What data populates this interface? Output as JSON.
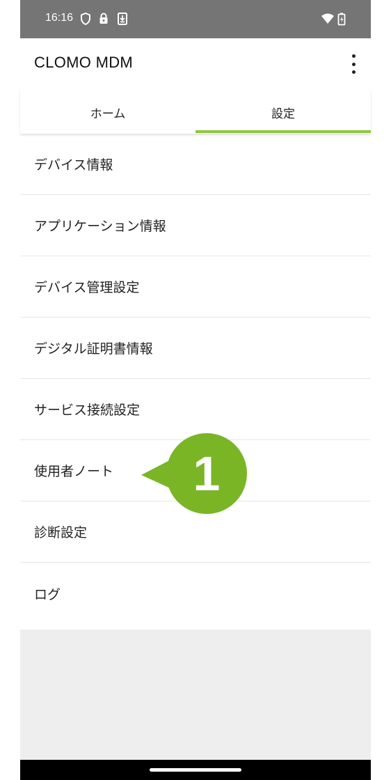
{
  "status_bar": {
    "time": "16:16",
    "icons": [
      "shield-icon",
      "lock-icon",
      "download-icon",
      "wifi-icon",
      "battery-charging-icon"
    ]
  },
  "app_bar": {
    "title": "CLOMO MDM",
    "menu_icon": "more-vert-icon"
  },
  "tabs": [
    {
      "label": "ホーム",
      "selected": false
    },
    {
      "label": "設定",
      "selected": true
    }
  ],
  "settings_list": [
    {
      "label": "デバイス情報"
    },
    {
      "label": "アプリケーション情報"
    },
    {
      "label": "デバイス管理設定"
    },
    {
      "label": "デジタル証明書情報"
    },
    {
      "label": "サービス接続設定"
    },
    {
      "label": "使用者ノート"
    },
    {
      "label": "診断設定"
    },
    {
      "label": "ログ"
    }
  ],
  "callout": {
    "number": "1"
  },
  "colors": {
    "accent": "#8dc63f",
    "status_bar": "#757575",
    "callout": "#7ab526"
  }
}
